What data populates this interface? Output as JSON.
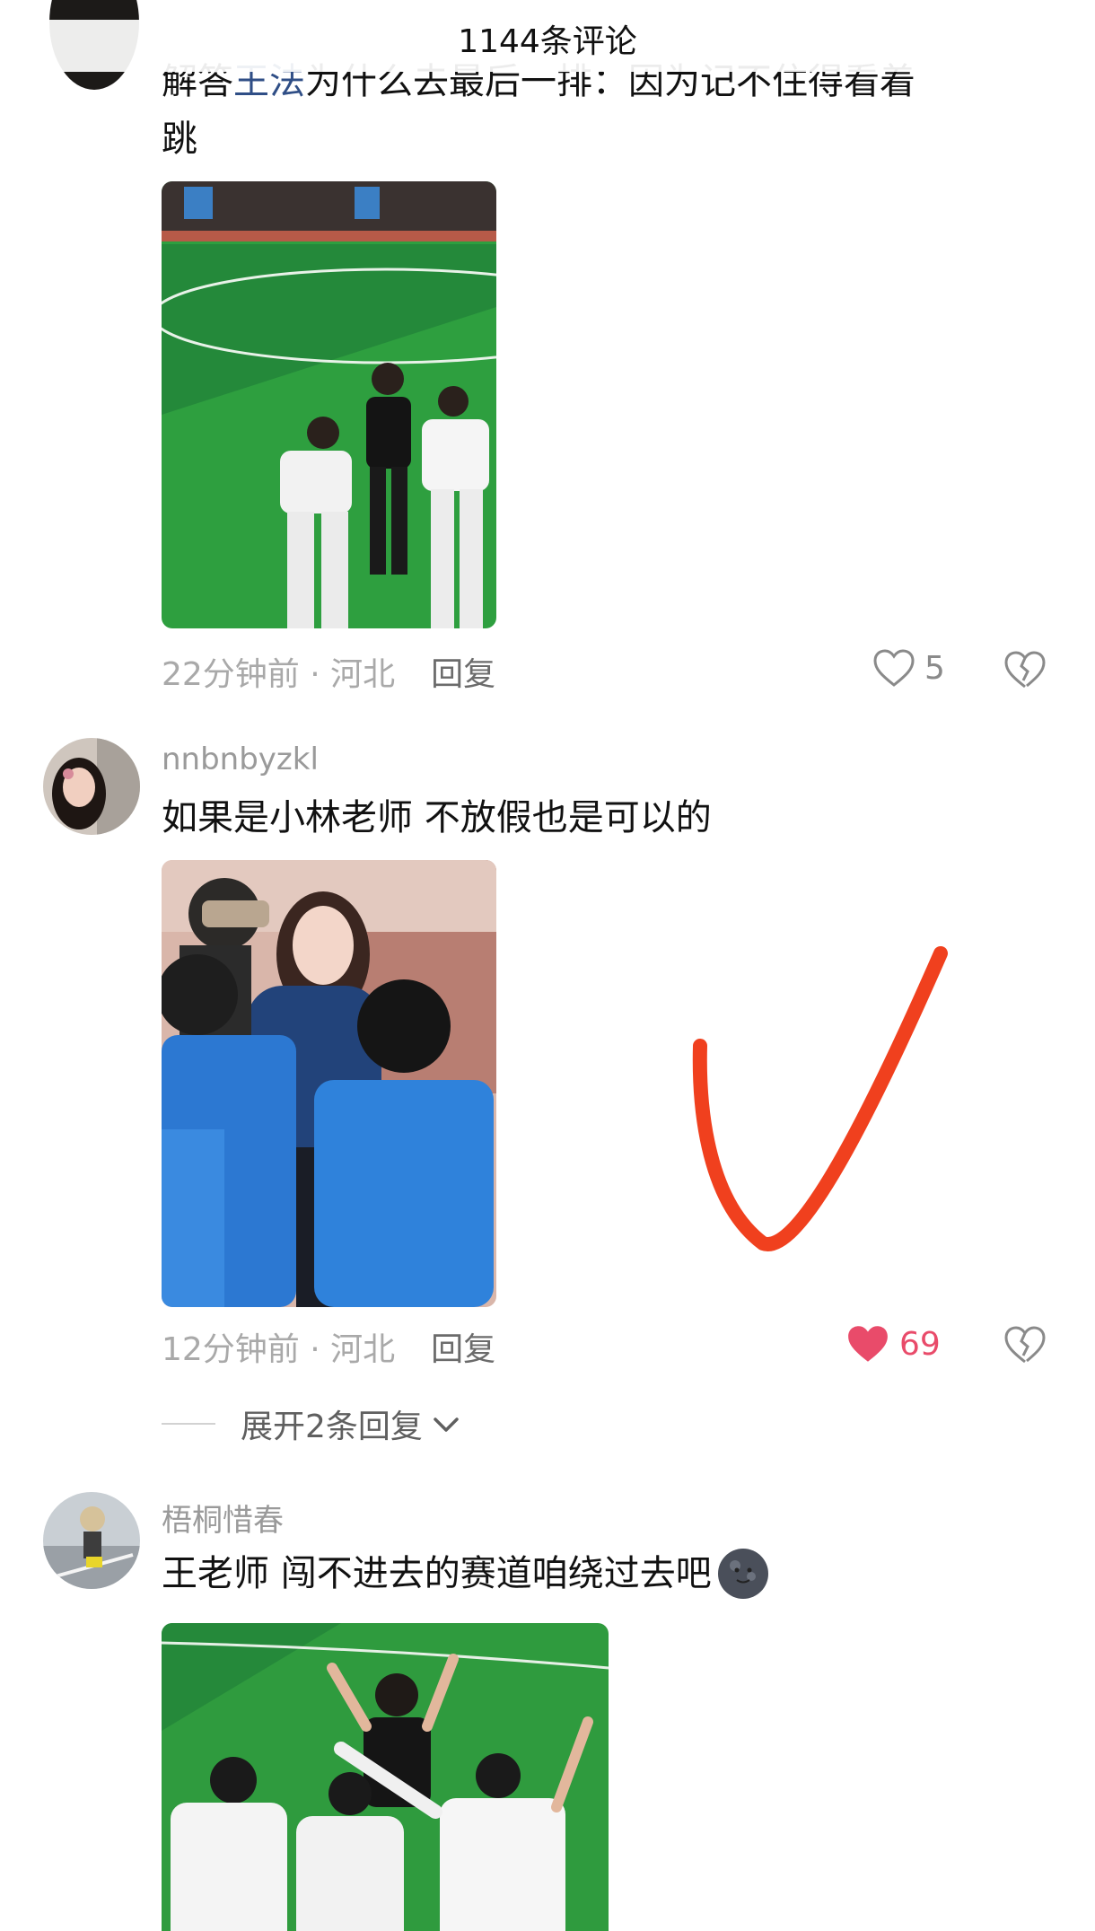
{
  "header": {
    "title": "1144条评论"
  },
  "comments": [
    {
      "text_part1": "解答",
      "mention": "王法",
      "text_part2": "为什么去最后一排：因为记不住得看着",
      "text_line2": "跳",
      "meta": {
        "time": "22分钟前",
        "location": "河北",
        "reply": "回复"
      },
      "likes": "5"
    },
    {
      "username": "nnbnbyzkl",
      "text": "如果是小林老师 不放假也是可以的",
      "meta": {
        "time": "12分钟前",
        "location": "河北",
        "reply": "回复"
      },
      "likes": "69",
      "expand_label": "展开2条回复"
    },
    {
      "username": "梧桐惜春",
      "text": "王老师 闯不进去的赛道咱绕过去吧"
    }
  ],
  "colors": {
    "liked": "#e94b6a",
    "annotation": "#f0401e",
    "mention": "#2f4e86"
  },
  "icons": [
    "heart-outline-icon",
    "heart-filled-icon",
    "broken-heart-icon",
    "chevron-down-icon",
    "emoji-icon",
    "checkmark-annotation"
  ]
}
